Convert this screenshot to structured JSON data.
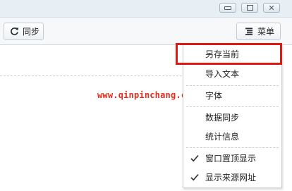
{
  "toolbar": {
    "sync_label": "同步",
    "menu_label": "菜单"
  },
  "watermark": {
    "text": "www.qinpinchang.com"
  },
  "menu": {
    "items": [
      {
        "label": "另存当前",
        "checked": false,
        "highlighted": true
      },
      {
        "label": "导入文本",
        "checked": false
      },
      {
        "label": "字体",
        "checked": false
      },
      {
        "label": "数据同步",
        "checked": false
      },
      {
        "label": "统计信息",
        "checked": false
      },
      {
        "label": "窗口置顶显示",
        "checked": true
      },
      {
        "label": "显示来源网址",
        "checked": true
      }
    ]
  },
  "colors": {
    "highlight_border": "#e01a12",
    "watermark": "#e52a1e",
    "titlebar_bg": "#e8eff4"
  },
  "icons": [
    "minimize-icon",
    "maximize-icon",
    "close-icon",
    "sync-icon",
    "menu-list-icon",
    "check-icon"
  ]
}
